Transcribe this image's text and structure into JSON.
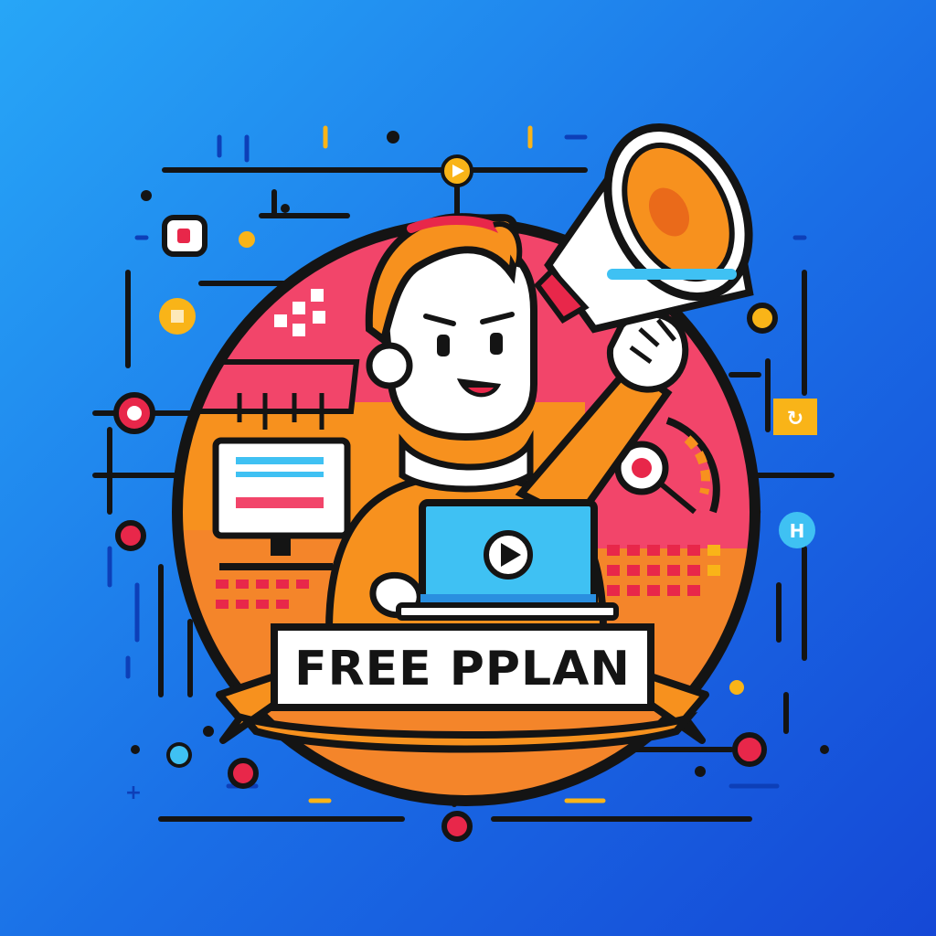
{
  "banner": {
    "text": "FREE PPLAN"
  },
  "colors": {
    "background_top_left": "#27a6f7",
    "background_bottom_right": "#1548d6",
    "outline": "#141414",
    "orange": "#f7911e",
    "orange_dark": "#ea6a1a",
    "pink": "#f2456a",
    "red": "#e8274a",
    "yellow": "#f9b418",
    "cyan": "#3fc1f3",
    "white": "#ffffff",
    "skin": "#ffffff"
  },
  "icons": [
    "megaphone-icon",
    "laptop-icon",
    "play-icon",
    "monitor-icon",
    "target-icon",
    "circuit-node-icon"
  ]
}
